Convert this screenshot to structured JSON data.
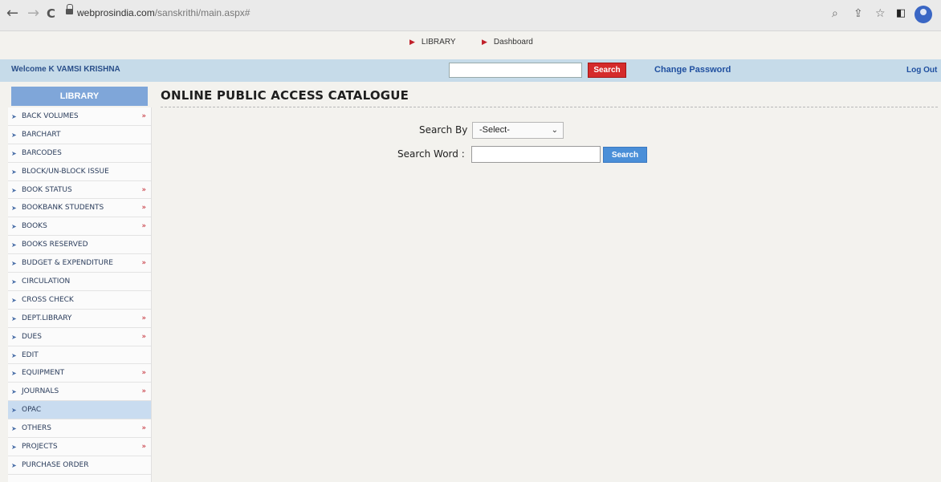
{
  "browser": {
    "url_host": "webprosindia.com",
    "url_path": "/sanskrithi/main.aspx#"
  },
  "top_links": [
    "LIBRARY",
    "Dashboard"
  ],
  "header": {
    "welcome": "Welcome K VAMSI KRISHNA",
    "search_button": "Search",
    "change_password": "Change Password",
    "logout": "Log Out"
  },
  "sidebar": {
    "title": "LIBRARY",
    "items": [
      {
        "label": "BACK VOLUMES",
        "more": true
      },
      {
        "label": "BARCHART",
        "more": false
      },
      {
        "label": "BARCODES",
        "more": false
      },
      {
        "label": "BLOCK/UN-BLOCK ISSUE",
        "more": false
      },
      {
        "label": "BOOK STATUS",
        "more": true
      },
      {
        "label": "BOOKBANK STUDENTS",
        "more": true
      },
      {
        "label": "BOOKS",
        "more": true
      },
      {
        "label": "BOOKS RESERVED",
        "more": false
      },
      {
        "label": "BUDGET & EXPENDITURE",
        "more": true
      },
      {
        "label": "CIRCULATION",
        "more": false
      },
      {
        "label": "CROSS CHECK",
        "more": false
      },
      {
        "label": "DEPT.LIBRARY",
        "more": true
      },
      {
        "label": "DUES",
        "more": true
      },
      {
        "label": "EDIT",
        "more": false
      },
      {
        "label": "EQUIPMENT",
        "more": true
      },
      {
        "label": "JOURNALS",
        "more": true
      },
      {
        "label": "OPAC",
        "more": false,
        "active": true
      },
      {
        "label": "OTHERS",
        "more": true
      },
      {
        "label": "PROJECTS",
        "more": true
      },
      {
        "label": "PURCHASE ORDER",
        "more": false
      }
    ]
  },
  "main": {
    "title": "ONLINE PUBLIC ACCESS CATALOGUE",
    "search_by_label": "Search By",
    "search_by_value": "-Select-",
    "search_word_label": "Search Word :",
    "search_button": "Search"
  },
  "colors": {
    "header_bar": "#c6dbe9",
    "sidebar_head": "#7fa6d9",
    "search_red": "#d52b2b",
    "search_blue": "#4a8fd8"
  }
}
